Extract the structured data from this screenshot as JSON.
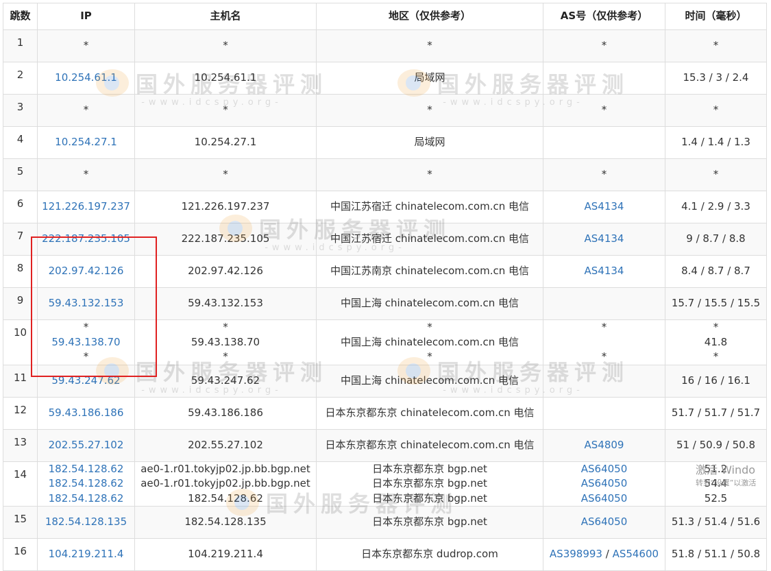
{
  "columns": [
    "跳数",
    "IP",
    "主机名",
    "地区（仅供参考）",
    "AS号（仅供参考）",
    "时间（毫秒）"
  ],
  "rows": [
    {
      "hop": "1",
      "ip": [
        "*"
      ],
      "host": [
        "*"
      ],
      "region": [
        "*"
      ],
      "as": [
        [
          "*"
        ]
      ],
      "time": [
        "*"
      ]
    },
    {
      "hop": "2",
      "ip": [
        "10.254.61.1"
      ],
      "host": [
        "10.254.61.1"
      ],
      "region": [
        "局域网"
      ],
      "as": [],
      "time": [
        "15.3 / 3 / 2.4"
      ]
    },
    {
      "hop": "3",
      "ip": [
        "*"
      ],
      "host": [
        "*"
      ],
      "region": [
        "*"
      ],
      "as": [
        [
          "*"
        ]
      ],
      "time": [
        "*"
      ]
    },
    {
      "hop": "4",
      "ip": [
        "10.254.27.1"
      ],
      "host": [
        "10.254.27.1"
      ],
      "region": [
        "局域网"
      ],
      "as": [],
      "time": [
        "1.4 / 1.4 / 1.3"
      ]
    },
    {
      "hop": "5",
      "ip": [
        "*"
      ],
      "host": [
        "*"
      ],
      "region": [
        "*"
      ],
      "as": [
        [
          "*"
        ]
      ],
      "time": [
        "*"
      ]
    },
    {
      "hop": "6",
      "ip": [
        "121.226.197.237"
      ],
      "host": [
        "121.226.197.237"
      ],
      "region": [
        "中国江苏宿迁 chinatelecom.com.cn 电信"
      ],
      "as": [
        [
          "AS4134"
        ]
      ],
      "time": [
        "4.1 / 2.9 / 3.3"
      ]
    },
    {
      "hop": "7",
      "ip": [
        "222.187.235.105"
      ],
      "host": [
        "222.187.235.105"
      ],
      "region": [
        "中国江苏宿迁 chinatelecom.com.cn 电信"
      ],
      "as": [
        [
          "AS4134"
        ]
      ],
      "time": [
        "9 / 8.7 / 8.8"
      ]
    },
    {
      "hop": "8",
      "ip": [
        "202.97.42.126"
      ],
      "host": [
        "202.97.42.126"
      ],
      "region": [
        "中国江苏南京 chinatelecom.com.cn 电信"
      ],
      "as": [
        [
          "AS4134"
        ]
      ],
      "time": [
        "8.4 / 8.7 / 8.7"
      ]
    },
    {
      "hop": "9",
      "ip": [
        "59.43.132.153"
      ],
      "host": [
        "59.43.132.153"
      ],
      "region": [
        "中国上海 chinatelecom.com.cn 电信"
      ],
      "as": [],
      "time": [
        "15.7 / 15.5 / 15.5"
      ]
    },
    {
      "hop": "10",
      "ip": [
        "*",
        "59.43.138.70",
        "*"
      ],
      "host": [
        "*",
        "59.43.138.70",
        "*"
      ],
      "region": [
        "*",
        "中国上海 chinatelecom.com.cn 电信",
        "*"
      ],
      "as": [
        [
          "*"
        ],
        [],
        [
          "*"
        ]
      ],
      "time": [
        "*",
        "41.8",
        "*"
      ]
    },
    {
      "hop": "11",
      "ip": [
        "59.43.247.62"
      ],
      "host": [
        "59.43.247.62"
      ],
      "region": [
        "中国上海 chinatelecom.com.cn 电信"
      ],
      "as": [],
      "time": [
        "16 / 16 / 16.1"
      ]
    },
    {
      "hop": "12",
      "ip": [
        "59.43.186.186"
      ],
      "host": [
        "59.43.186.186"
      ],
      "region": [
        "日本东京都东京 chinatelecom.com.cn 电信"
      ],
      "as": [],
      "time": [
        "51.7 / 51.7 / 51.7"
      ]
    },
    {
      "hop": "13",
      "ip": [
        "202.55.27.102"
      ],
      "host": [
        "202.55.27.102"
      ],
      "region": [
        "日本东京都东京 chinatelecom.com.cn 电信"
      ],
      "as": [
        [
          "AS4809"
        ]
      ],
      "time": [
        "51 / 50.9 / 50.8"
      ]
    },
    {
      "hop": "14",
      "ip": [
        "182.54.128.62",
        "182.54.128.62",
        "182.54.128.62"
      ],
      "host": [
        "ae0-1.r01.tokyjp02.jp.bb.bgp.net",
        "ae0-1.r01.tokyjp02.jp.bb.bgp.net",
        "182.54.128.62"
      ],
      "region": [
        "日本东京都东京 bgp.net",
        "日本东京都东京 bgp.net",
        "日本东京都东京 bgp.net"
      ],
      "as": [
        [
          "AS64050"
        ],
        [
          "AS64050"
        ],
        [
          "AS64050"
        ]
      ],
      "time": [
        "51.2",
        "54.4",
        "52.5"
      ]
    },
    {
      "hop": "15",
      "ip": [
        "182.54.128.135"
      ],
      "host": [
        "182.54.128.135"
      ],
      "region": [
        "日本东京都东京 bgp.net"
      ],
      "as": [
        [
          "AS64050"
        ]
      ],
      "time": [
        "51.3 / 51.4 / 51.6"
      ]
    },
    {
      "hop": "16",
      "ip": [
        "104.219.211.4"
      ],
      "host": [
        "104.219.211.4"
      ],
      "region": [
        "日本东京都东京 dudrop.com"
      ],
      "as": [
        [
          "AS398993",
          "AS54600"
        ]
      ],
      "time": [
        "51.8 / 51.1 / 50.8"
      ]
    }
  ],
  "as_separator": " / ",
  "watermark": {
    "main": "国外服务器评测",
    "sub": "-www.idcspy.org-"
  },
  "os_overlay": {
    "line1": "激活 Windo",
    "line2": "转到“设置”以激活"
  },
  "colors": {
    "link": "#2f73b8",
    "highlight": "#e02020",
    "border": "#dddddd",
    "stripe": "#f9f9f9"
  }
}
